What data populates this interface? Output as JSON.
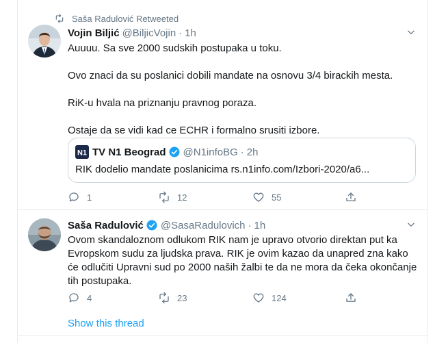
{
  "retweet": {
    "text": "Saša Radulović Retweeted"
  },
  "tweets": [
    {
      "name": "Vojin Biljić",
      "handle": "@BiljicVojin",
      "time": "1h",
      "paragraphs": [
        "Auuuu. Sa sve 2000 sudskih postupaka u toku.",
        "Ovo znaci da su poslanici dobili mandate na osnovu 3/4 birackih mesta.",
        "RiK-u hvala na priznanju pravnog poraza.",
        "Ostaje da se vidi kad ce ECHR i formalno srusiti izbore."
      ],
      "quote": {
        "logo_text": "N1",
        "name": "TV N1 Beograd",
        "handle": "@N1infoBG",
        "time": "2h",
        "text": "RIK dodelio mandate poslanicima rs.n1info.com/Izbori-2020/a6..."
      },
      "stats": {
        "replies": "1",
        "retweets": "12",
        "likes": "55"
      }
    },
    {
      "name": "Saša Radulović",
      "handle": "@SasaRadulovich",
      "time": "1h",
      "text": "Ovom skandaloznom odlukom RIK nam je upravo otvorio direktan put ka Evropskom sudu za ljudska prava. RIK je ovim kazao da unapred zna kako će odlučiti Upravni sud po 2000 naših žalbi te da ne mora da čeka okončanje tih postupaka.",
      "stats": {
        "replies": "4",
        "retweets": "23",
        "likes": "124"
      }
    }
  ],
  "show_thread": "Show this thread",
  "colors": {
    "accent": "#1da1f2",
    "muted": "#657786",
    "border": "#e6ecf0"
  },
  "icons": [
    "retweet-icon",
    "verified-icon",
    "caret-down-icon",
    "reply-icon",
    "like-icon",
    "share-icon"
  ]
}
